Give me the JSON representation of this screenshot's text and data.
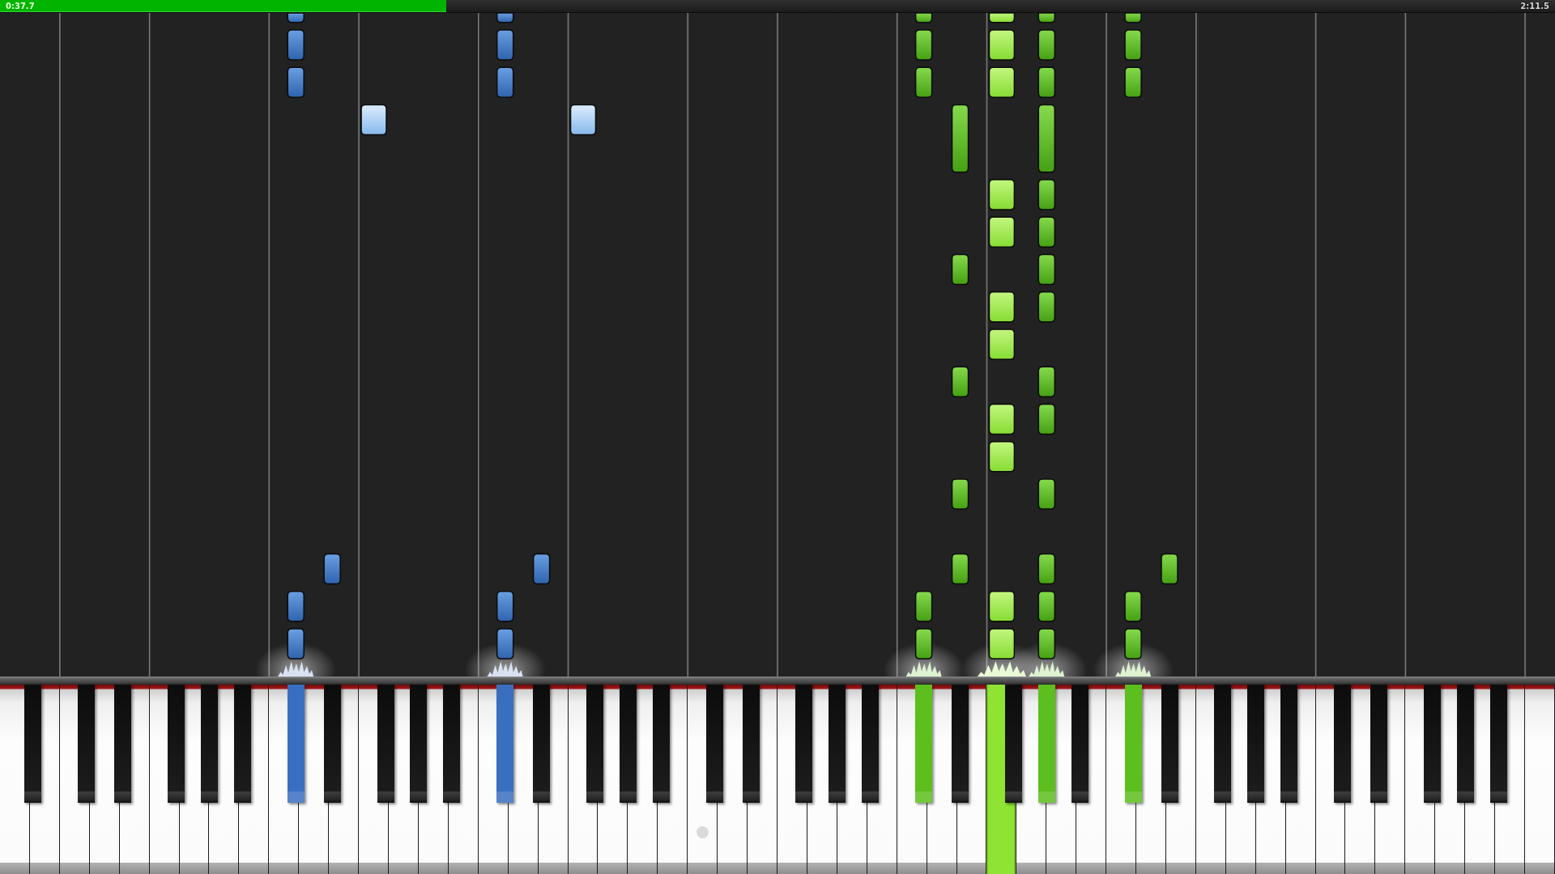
{
  "progress": {
    "elapsed": "0:37.7",
    "total": "2:11.5",
    "level": 0.287
  },
  "keyboard": {
    "keys": [
      {
        "kind": "white",
        "pressed": false
      },
      {
        "kind": "black",
        "pressed": false
      },
      {
        "kind": "white",
        "pressed": false
      },
      {
        "kind": "white",
        "pressed": false
      },
      {
        "kind": "black",
        "pressed": false
      },
      {
        "kind": "white",
        "pressed": false
      },
      {
        "kind": "black",
        "pressed": false
      },
      {
        "kind": "white",
        "pressed": false
      },
      {
        "kind": "white",
        "pressed": false
      },
      {
        "kind": "black",
        "pressed": false
      },
      {
        "kind": "white",
        "pressed": false
      },
      {
        "kind": "black",
        "pressed": false
      },
      {
        "kind": "white",
        "pressed": false
      },
      {
        "kind": "black",
        "pressed": false
      },
      {
        "kind": "white",
        "pressed": false
      },
      {
        "kind": "white",
        "pressed": false
      },
      {
        "kind": "black",
        "pressed": true,
        "color": "#3a6fc0"
      },
      {
        "kind": "white",
        "pressed": false
      },
      {
        "kind": "black",
        "pressed": false
      },
      {
        "kind": "white",
        "pressed": false
      },
      {
        "kind": "white",
        "pressed": false
      },
      {
        "kind": "black",
        "pressed": false
      },
      {
        "kind": "white",
        "pressed": false
      },
      {
        "kind": "black",
        "pressed": false
      },
      {
        "kind": "white",
        "pressed": false
      },
      {
        "kind": "black",
        "pressed": false
      },
      {
        "kind": "white",
        "pressed": false
      },
      {
        "kind": "white",
        "pressed": false
      },
      {
        "kind": "black",
        "pressed": true,
        "color": "#3a6fc0"
      },
      {
        "kind": "white",
        "pressed": false
      },
      {
        "kind": "black",
        "pressed": false
      },
      {
        "kind": "white",
        "pressed": false
      },
      {
        "kind": "white",
        "pressed": false
      },
      {
        "kind": "black",
        "pressed": false
      },
      {
        "kind": "white",
        "pressed": false
      },
      {
        "kind": "black",
        "pressed": false
      },
      {
        "kind": "white",
        "pressed": false
      },
      {
        "kind": "black",
        "pressed": false
      },
      {
        "kind": "white",
        "pressed": false
      },
      {
        "kind": "white",
        "pressed": false
      },
      {
        "kind": "black",
        "pressed": false
      },
      {
        "kind": "white",
        "pressed": false
      },
      {
        "kind": "black",
        "pressed": false
      },
      {
        "kind": "white",
        "pressed": false
      },
      {
        "kind": "white",
        "pressed": false
      },
      {
        "kind": "black",
        "pressed": false
      },
      {
        "kind": "white",
        "pressed": false
      },
      {
        "kind": "black",
        "pressed": false
      },
      {
        "kind": "white",
        "pressed": false
      },
      {
        "kind": "black",
        "pressed": false
      },
      {
        "kind": "white",
        "pressed": false
      },
      {
        "kind": "white",
        "pressed": false
      },
      {
        "kind": "black",
        "pressed": true,
        "color": "#5cbf1e"
      },
      {
        "kind": "white",
        "pressed": false
      },
      {
        "kind": "black",
        "pressed": false
      },
      {
        "kind": "white",
        "pressed": false
      },
      {
        "kind": "white",
        "pressed": true,
        "color": "#8fe433"
      },
      {
        "kind": "black",
        "pressed": false
      },
      {
        "kind": "white",
        "pressed": false
      },
      {
        "kind": "black",
        "pressed": true,
        "color": "#5cbf1e"
      },
      {
        "kind": "white",
        "pressed": false
      },
      {
        "kind": "black",
        "pressed": false
      },
      {
        "kind": "white",
        "pressed": false
      },
      {
        "kind": "white",
        "pressed": false
      },
      {
        "kind": "black",
        "pressed": true,
        "color": "#5cbf1e"
      },
      {
        "kind": "white",
        "pressed": false
      },
      {
        "kind": "black",
        "pressed": false
      },
      {
        "kind": "white",
        "pressed": false
      },
      {
        "kind": "white",
        "pressed": false
      },
      {
        "kind": "black",
        "pressed": false
      },
      {
        "kind": "white",
        "pressed": false
      },
      {
        "kind": "black",
        "pressed": false
      },
      {
        "kind": "white",
        "pressed": false
      },
      {
        "kind": "black",
        "pressed": false
      },
      {
        "kind": "white",
        "pressed": false
      },
      {
        "kind": "white",
        "pressed": false
      },
      {
        "kind": "black",
        "pressed": false
      },
      {
        "kind": "white",
        "pressed": false
      },
      {
        "kind": "black",
        "pressed": false
      },
      {
        "kind": "white",
        "pressed": false
      },
      {
        "kind": "white",
        "pressed": false
      },
      {
        "kind": "black",
        "pressed": false
      },
      {
        "kind": "white",
        "pressed": false
      },
      {
        "kind": "black",
        "pressed": false
      },
      {
        "kind": "white",
        "pressed": false
      },
      {
        "kind": "black",
        "pressed": false
      },
      {
        "kind": "white",
        "pressed": false
      },
      {
        "kind": "white",
        "pressed": false
      }
    ]
  }
}
